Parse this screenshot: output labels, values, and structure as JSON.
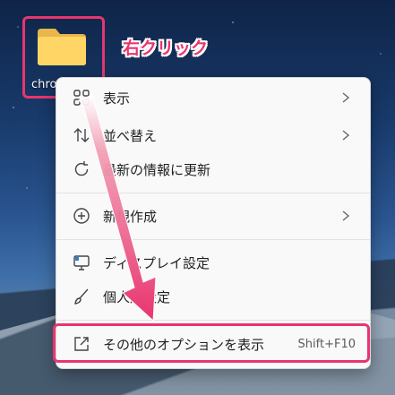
{
  "desktop": {
    "folder_label": "chro",
    "annotation": "右クリック"
  },
  "context_menu": {
    "items": [
      {
        "label": "表示",
        "icon": "grid-icon",
        "has_submenu": true
      },
      {
        "label": "並べ替え",
        "icon": "sort-icon",
        "has_submenu": true
      },
      {
        "label": "最新の情報に更新",
        "icon": "refresh-icon",
        "has_submenu": false
      },
      {
        "label": "新規作成",
        "icon": "add-circle-icon",
        "has_submenu": true
      },
      {
        "label": "ディスプレイ設定",
        "icon": "display-icon",
        "has_submenu": false
      },
      {
        "label": "個人用設定",
        "icon": "brush-icon",
        "has_submenu": false
      },
      {
        "label": "その他のオプションを表示",
        "icon": "external-icon",
        "shortcut": "Shift+F10"
      }
    ]
  },
  "colors": {
    "accent": "#e8356f",
    "menu_bg": "#f9f9f9"
  }
}
